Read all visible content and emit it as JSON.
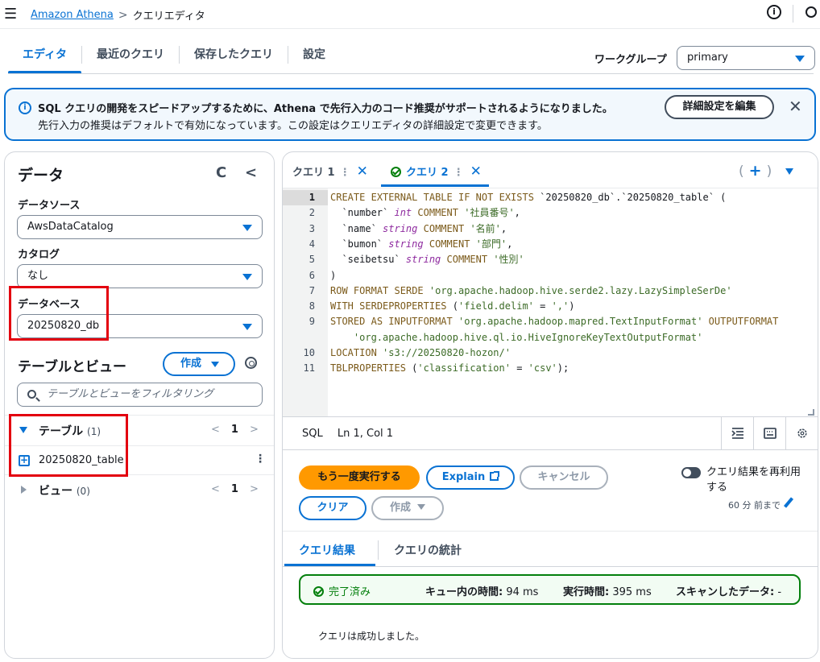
{
  "topbar": {
    "breadcrumb_root": "Amazon Athena",
    "breadcrumb_current": "クエリエディタ"
  },
  "tabs": [
    {
      "label": "エディタ"
    },
    {
      "label": "最近のクエリ"
    },
    {
      "label": "保存したクエリ"
    },
    {
      "label": "設定"
    }
  ],
  "workgroup": {
    "label": "ワークグループ",
    "value": "primary"
  },
  "flash": {
    "line1": "SQL クエリの開発をスピードアップするために、Athena で先行入力のコード推奨がサポートされるようになりました。",
    "line2": "先行入力の推奨はデフォルトで有効になっています。この設定はクエリエディタの詳細設定で変更できます。",
    "button": "詳細設定を編集"
  },
  "data_panel": {
    "title": "データ",
    "datasource_label": "データソース",
    "datasource_value": "AwsDataCatalog",
    "catalog_label": "カタログ",
    "catalog_value": "なし",
    "database_label": "データベース",
    "database_value": "20250820_db",
    "tables_views_title": "テーブルとビュー",
    "create_button": "作成",
    "filter_placeholder": "テーブルとビューをフィルタリング",
    "tables_label": "テーブル",
    "tables_count": "(1)",
    "tables_page": "1",
    "table_name": "20250820_table",
    "views_label": "ビュー",
    "views_count": "(0)",
    "views_page": "1"
  },
  "query_tabs": [
    {
      "label": "クエリ 1"
    },
    {
      "label": "クエリ 2"
    }
  ],
  "editor": {
    "lines": [
      {
        "n": "1",
        "text": "CREATE EXTERNAL TABLE IF NOT EXISTS `20250820_db`.`20250820_table` ("
      },
      {
        "n": "2",
        "text": "  `number` int COMMENT '社員番号',"
      },
      {
        "n": "3",
        "text": "  `name` string COMMENT '名前',"
      },
      {
        "n": "4",
        "text": "  `bumon` string COMMENT '部門',"
      },
      {
        "n": "5",
        "text": "  `seibetsu` string COMMENT '性別'"
      },
      {
        "n": "6",
        "text": ")"
      },
      {
        "n": "7",
        "text": "ROW FORMAT SERDE 'org.apache.hadoop.hive.serde2.lazy.LazySimpleSerDe'"
      },
      {
        "n": "8",
        "text": "WITH SERDEPROPERTIES ('field.delim' = ',')"
      },
      {
        "n": "9",
        "text": "STORED AS INPUTFORMAT 'org.apache.hadoop.mapred.TextInputFormat' OUTPUTFORMAT"
      },
      {
        "n": "",
        "text": "    'org.apache.hadoop.hive.ql.io.HiveIgnoreKeyTextOutputFormat'"
      },
      {
        "n": "10",
        "text": "LOCATION 's3://20250820-hozon/'"
      },
      {
        "n": "11",
        "text": "TBLPROPERTIES ('classification' = 'csv');"
      }
    ]
  },
  "statusbar": {
    "lang": "SQL",
    "position": "Ln 1, Col 1"
  },
  "actions": {
    "run": "もう一度実行する",
    "explain": "Explain",
    "cancel": "キャンセル",
    "clear": "クリア",
    "create": "作成",
    "reuse_label": "クエリ結果を再利用する",
    "reuse_time": "60 分 前まで"
  },
  "results": {
    "tab_results": "クエリ結果",
    "tab_stats": "クエリの統計",
    "status": "完了済み",
    "queue_label": "キュー内の時間:",
    "queue_value": "94 ms",
    "exec_label": "実行時間:",
    "exec_value": "395 ms",
    "scan_label": "スキャンしたデータ:",
    "scan_value": "-",
    "message": "クエリは成功しました。"
  },
  "colors": {
    "accent": "#0972d3",
    "primary_button": "#ff9900",
    "success": "#037f0c",
    "highlight_box": "#e3000f"
  }
}
